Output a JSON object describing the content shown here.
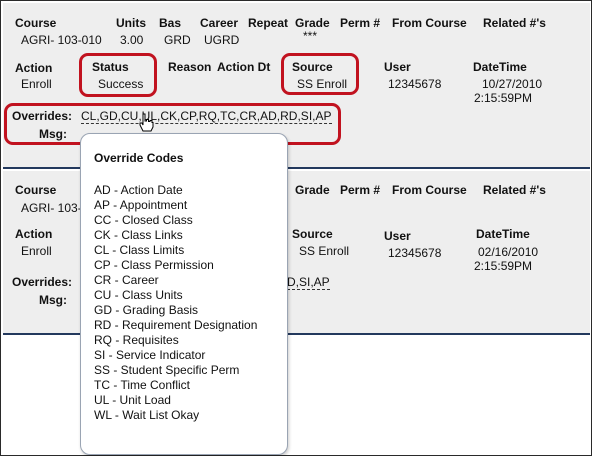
{
  "headers": {
    "course": "Course",
    "units": "Units",
    "bas": "Bas",
    "career": "Career",
    "repeat": "Repeat",
    "grade": "Grade",
    "perm": "Perm #",
    "from_course": "From Course",
    "related": "Related #'s",
    "action": "Action",
    "status": "Status",
    "reason": "Reason",
    "action_dt": "Action Dt",
    "source": "Source",
    "user": "User",
    "datetime": "DateTime",
    "overrides": "Overrides:",
    "msg": "Msg:"
  },
  "record1": {
    "course": "AGRI- 103-010",
    "units": "3.00",
    "bas": "GRD",
    "career": "UGRD",
    "grade": "***",
    "action": "Enroll",
    "status": "Success",
    "source": "SS Enroll",
    "user": "12345678",
    "date": "10/27/2010",
    "time": "2:15:59PM",
    "overrides": "CL,GD,CU,UL,CK,CP,RQ,TC,CR,AD,RD,SI,AP"
  },
  "record2": {
    "course_visible": "AGRI- 103-",
    "action": "Enroll",
    "source": "SS Enroll",
    "user": "12345678",
    "date": "02/16/2010",
    "time": "2:15:59PM",
    "overrides_tail": "D,SI,AP"
  },
  "popup": {
    "title": "Override Codes",
    "codes": [
      "AD - Action Date",
      "AP - Appointment",
      "CC - Closed Class",
      "CK - Class Links",
      "CL - Class Limits",
      "CP - Class Permission",
      "CR - Career",
      "CU - Class Units",
      "GD - Grading Basis",
      "RD - Requirement Designation",
      "RQ - Requisites",
      "SI - Service Indicator",
      "SS - Student Specific Perm",
      "TC - Time Conflict",
      "UL - Unit Load",
      "WL - Wait List Okay"
    ]
  },
  "colors": {
    "highlight": "#c1121f",
    "divider": "#23395d",
    "panel": "#eeeeee"
  }
}
